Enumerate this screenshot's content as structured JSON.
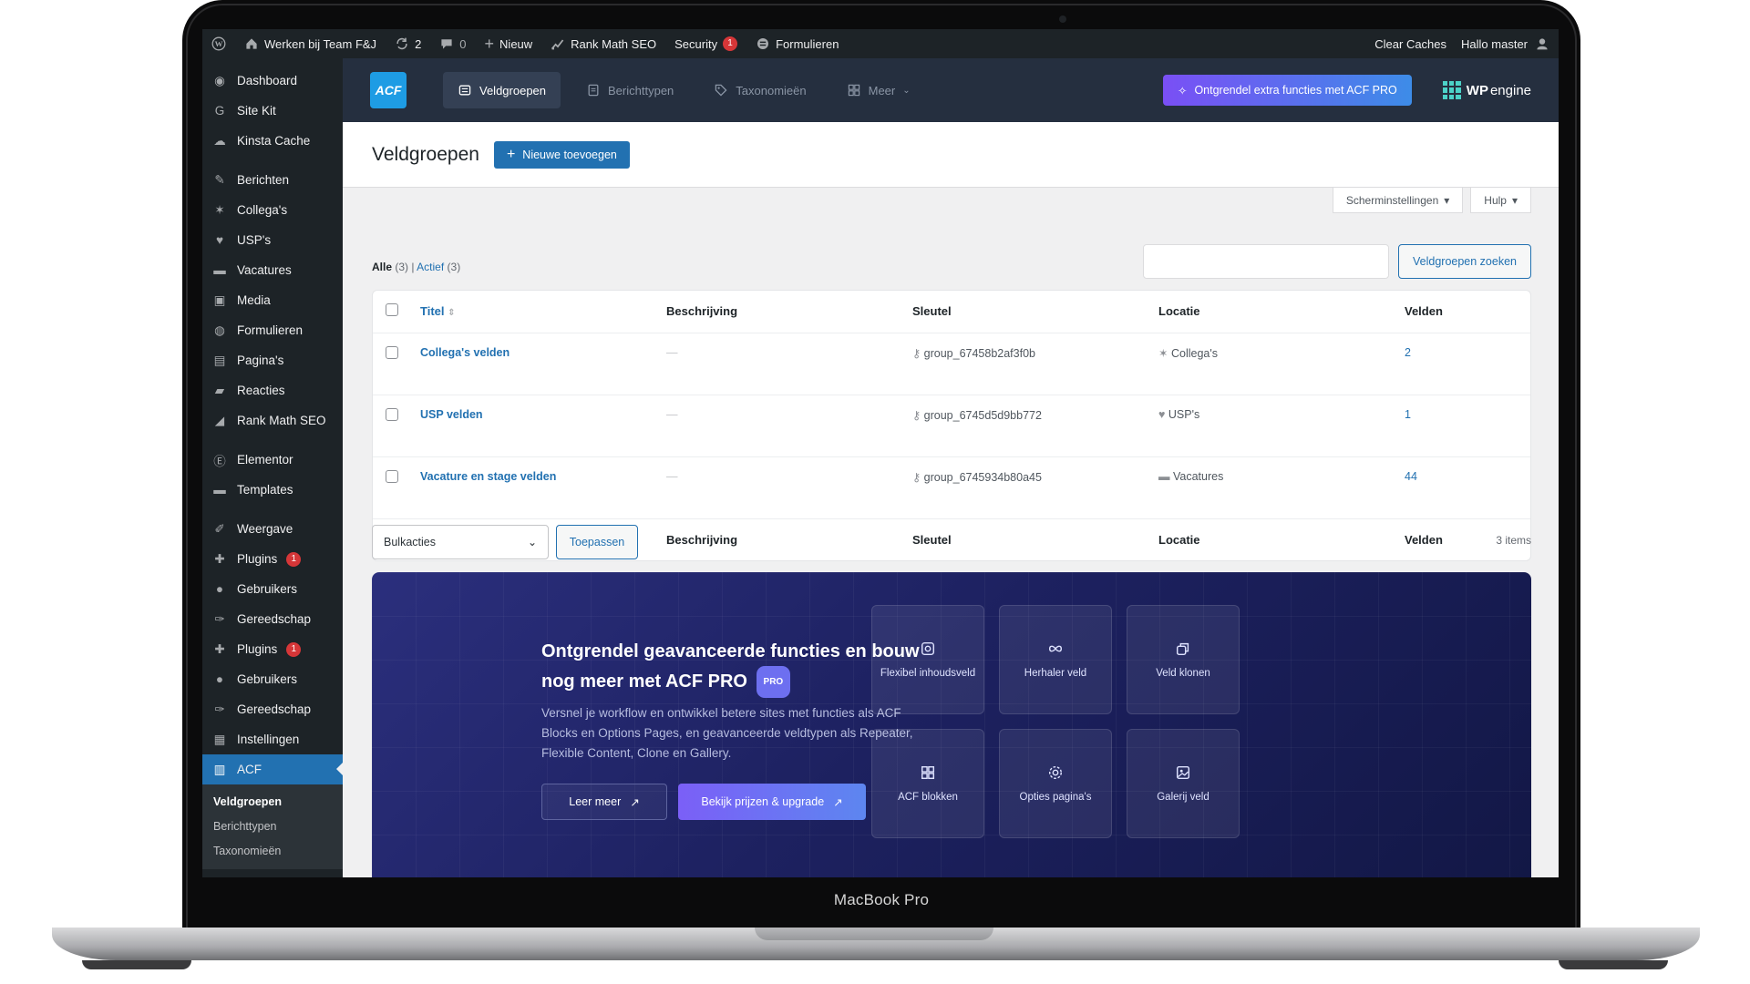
{
  "device": {
    "brand": "MacBook Pro"
  },
  "adminbar": {
    "site_name": "Werken bij Team F&J",
    "updates_count": "2",
    "comments_count": "0",
    "new_label": "Nieuw",
    "rank_math": "Rank Math SEO",
    "security": "Security",
    "security_badge": "1",
    "forms": "Formulieren",
    "clear_caches": "Clear Caches",
    "greeting": "Hallo master"
  },
  "sidebar": {
    "items": [
      {
        "label": "Dashboard",
        "icon": "dashboard-icon"
      },
      {
        "label": "Site Kit",
        "icon": "google-icon"
      },
      {
        "label": "Kinsta Cache",
        "icon": "cloud-icon"
      },
      {
        "label": "Berichten",
        "icon": "pin-icon"
      },
      {
        "label": "Collega's",
        "icon": "star-icon"
      },
      {
        "label": "USP's",
        "icon": "heart-icon"
      },
      {
        "label": "Vacatures",
        "icon": "folder-icon"
      },
      {
        "label": "Media",
        "icon": "media-icon"
      },
      {
        "label": "Formulieren",
        "icon": "form-icon"
      },
      {
        "label": "Pagina's",
        "icon": "page-icon"
      },
      {
        "label": "Reacties",
        "icon": "comment-icon"
      },
      {
        "label": "Rank Math SEO",
        "icon": "chart-icon"
      },
      {
        "label": "Elementor",
        "icon": "elementor-icon"
      },
      {
        "label": "Templates",
        "icon": "folder-icon"
      },
      {
        "label": "Weergave",
        "icon": "brush-icon"
      },
      {
        "label": "Plugins",
        "icon": "plug-icon",
        "badge": "1"
      },
      {
        "label": "Gebruikers",
        "icon": "user-icon"
      },
      {
        "label": "Gereedschap",
        "icon": "wrench-icon"
      },
      {
        "label": "Plugins",
        "icon": "plug-icon",
        "badge": "1"
      },
      {
        "label": "Gebruikers",
        "icon": "user-icon"
      },
      {
        "label": "Gereedschap",
        "icon": "wrench-icon"
      },
      {
        "label": "Instellingen",
        "icon": "settings-icon"
      },
      {
        "label": "ACF",
        "icon": "acf-icon"
      }
    ],
    "submenu": [
      "Veldgroepen",
      "Berichttypen",
      "Taxonomieën"
    ]
  },
  "acf_nav": {
    "logo": "ACF",
    "tabs": [
      "Veldgroepen",
      "Berichttypen",
      "Taxonomieën",
      "Meer"
    ],
    "upgrade": "Ontgrendel extra functies met ACF PRO",
    "host_wp": "WP",
    "host_engine": "engine"
  },
  "page": {
    "title": "Veldgroepen",
    "add_new": "Nieuwe toevoegen",
    "screen_options": "Scherminstellingen",
    "help": "Hulp",
    "filter_all": "Alle",
    "filter_all_count": "(3)",
    "filter_active": "Actief",
    "filter_active_count": "(3)",
    "search_button": "Veldgroepen zoeken",
    "search_value": "",
    "bulk_actions": "Bulkacties",
    "apply": "Toepassen",
    "items_count": "3 items"
  },
  "table": {
    "columns": [
      "Titel",
      "Beschrijving",
      "Sleutel",
      "Locatie",
      "Velden"
    ],
    "rows": [
      {
        "title": "Collega's velden",
        "description": "—",
        "key": "group_67458b2af3f0b",
        "location": "Collega's",
        "location_icon": "star-icon",
        "fields": "2"
      },
      {
        "title": "USP velden",
        "description": "—",
        "key": "group_6745d5d9bb772",
        "location": "USP's",
        "location_icon": "heart-icon",
        "fields": "1"
      },
      {
        "title": "Vacature en stage velden",
        "description": "—",
        "key": "group_6745934b80a45",
        "location": "Vacatures",
        "location_icon": "folder-icon",
        "fields": "44"
      }
    ]
  },
  "promo": {
    "title": "Ontgrendel geavanceerde functies en bouw nog meer met ACF PRO",
    "pro_badge": "PRO",
    "description": "Versnel je workflow en ontwikkel betere sites met functies als ACF Blocks en Options Pages, en geavanceerde veldtypen als Repeater, Flexible Content, Clone en Gallery.",
    "learn_more": "Leer meer",
    "pricing": "Bekijk prijzen & upgrade",
    "features": [
      {
        "label": "Flexibel inhoudsveld",
        "icon": "flexible-content-icon"
      },
      {
        "label": "Herhaler veld",
        "icon": "infinity-icon"
      },
      {
        "label": "Veld klonen",
        "icon": "clone-icon"
      },
      {
        "label": "ACF blokken",
        "icon": "blocks-icon"
      },
      {
        "label": "Opties pagina's",
        "icon": "gear-icon"
      },
      {
        "label": "Galerij veld",
        "icon": "gallery-icon"
      }
    ]
  },
  "colors": {
    "wp_dark": "#1d2327",
    "wp_blue": "#2271b1",
    "acf_nav": "#252f3f"
  }
}
